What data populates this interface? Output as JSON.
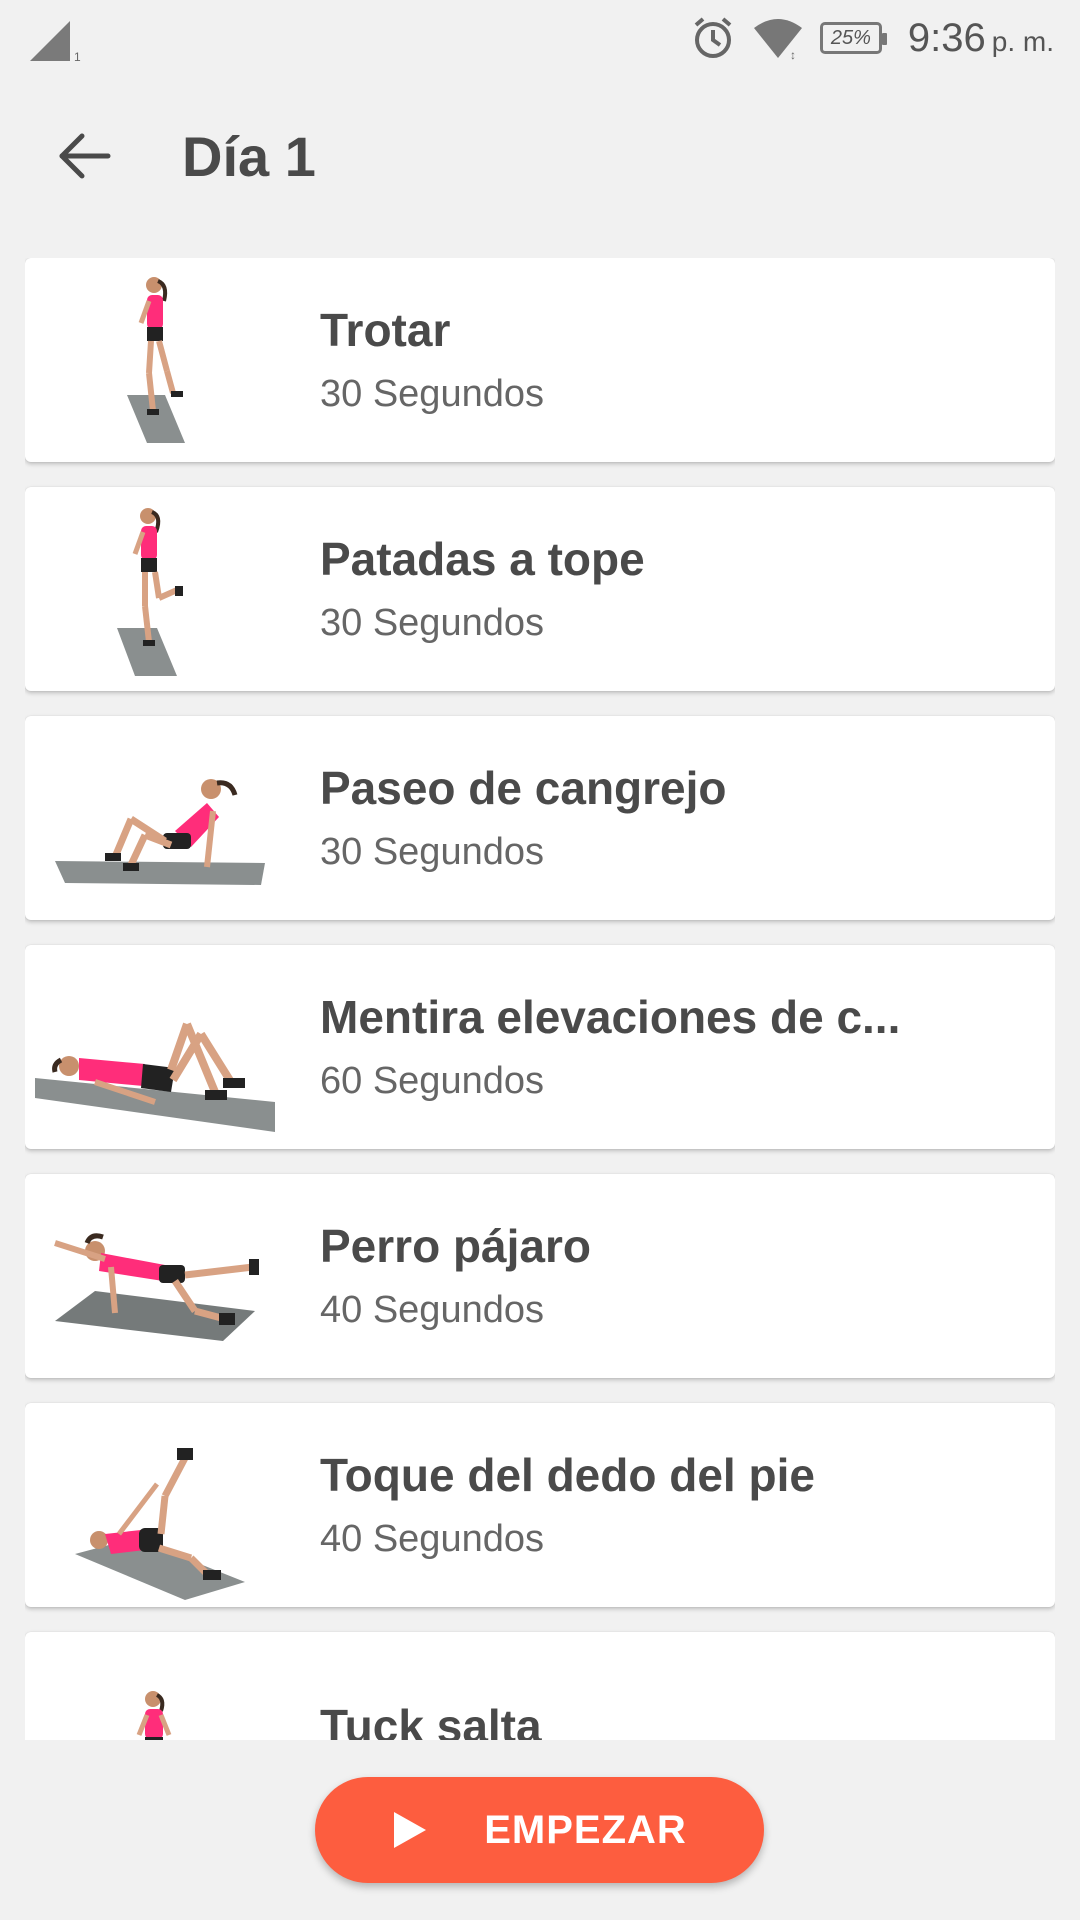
{
  "status_bar": {
    "time": "9:36",
    "ampm": "p. m.",
    "battery": "25%",
    "icons": [
      "signal-icon",
      "alarm-icon",
      "wifi-icon",
      "battery-icon"
    ]
  },
  "header": {
    "title": "Día 1",
    "back_icon": "arrow-left-icon"
  },
  "exercises": [
    {
      "name": "Trotar",
      "duration": "30 Segundos",
      "thumb": "jogging-figure-icon"
    },
    {
      "name": "Patadas a tope",
      "duration": "30 Segundos",
      "thumb": "butt-kicks-figure-icon"
    },
    {
      "name": "Paseo de cangrejo",
      "duration": "30 Segundos",
      "thumb": "crab-walk-figure-icon"
    },
    {
      "name": "Mentira elevaciones de c...",
      "duration": "60 Segundos",
      "thumb": "hip-raise-figure-icon"
    },
    {
      "name": "Perro pájaro",
      "duration": "40 Segundos",
      "thumb": "bird-dog-figure-icon"
    },
    {
      "name": "Toque del dedo del pie",
      "duration": "40 Segundos",
      "thumb": "toe-touch-figure-icon"
    },
    {
      "name": "Tuck salta",
      "duration": "",
      "thumb": "tuck-jump-figure-icon"
    }
  ],
  "start_button": {
    "label": "EMPEZAR",
    "icon": "play-icon"
  },
  "colors": {
    "accent": "#fd5d3f",
    "background": "#f1f1f1",
    "text": "#4a4a4a",
    "top_pink": "#ff2d7a",
    "mat_gray": "#8a8f8f"
  }
}
